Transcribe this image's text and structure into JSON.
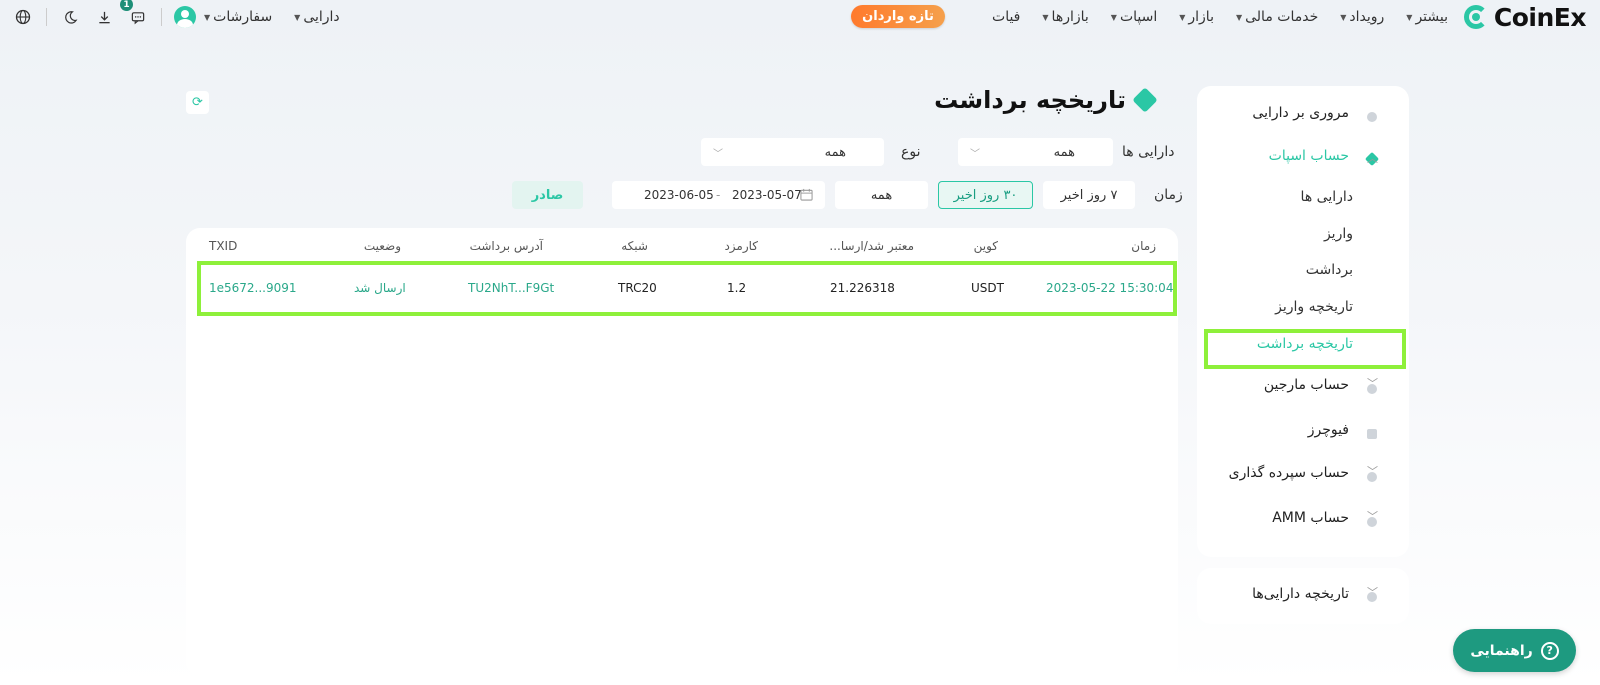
{
  "header": {
    "brand": "CoinEx",
    "nav": [
      {
        "label": "فیات",
        "caret": false
      },
      {
        "label": "بازارها",
        "caret": true
      },
      {
        "label": "اسپات",
        "caret": true
      },
      {
        "label": "بازار",
        "caret": true
      },
      {
        "label": "خدمات مالی",
        "caret": true
      },
      {
        "label": "رویداد",
        "caret": true
      },
      {
        "label": "بیشتر",
        "caret": true
      }
    ],
    "cta": "تازه واردان",
    "assets_menu": "دارایی",
    "orders_menu": "سفارشات",
    "notification_count": "1"
  },
  "sidebar": {
    "overview": "مروری بر دارایی",
    "spot_account": "حساب اسپات",
    "spot_sub": [
      "دارایی ها",
      "واریز",
      "برداشت",
      "تاریخچه واریز",
      "تاریخچه برداشت"
    ],
    "margin_account": "حساب مارجین",
    "futures": "فیوچرز",
    "staking_account": "حساب سپرده گذاری",
    "amm_account": "حساب AMM",
    "assets_history": "تاریخچه دارایی‌ها"
  },
  "main": {
    "title": "تاریخچه برداشت",
    "filters": {
      "asset_label": "دارایی ها",
      "asset_value": "همه",
      "type_label": "نوع",
      "type_value": "همه",
      "time_label": "زمان",
      "range_7": "۷ روز اخیر",
      "range_30": "۳۰ روز اخیر",
      "range_all": "همه",
      "date_start": "2023-05-07",
      "date_sep": "-",
      "date_end": "2023-06-05",
      "export": "صادر"
    },
    "table": {
      "headers": {
        "time": "زمان",
        "coin": "کوین",
        "amount": "معتبر شد/ارسا...",
        "fee": "کارمزد",
        "network": "شبکه",
        "address": "آدرس برداشت",
        "status": "وضعیت",
        "txid": "TXID"
      },
      "rows": [
        {
          "time": "2023-05-22  15:30:04",
          "coin": "USDT",
          "amount": "21.226318",
          "fee": "1.2",
          "network": "TRC20",
          "address": "TU2NhT...F9Gt",
          "status": "ارسال شد",
          "txid": "1e5672...9091"
        }
      ]
    }
  },
  "help_button": "راهنمایی",
  "colors": {
    "accent": "#2bc7a5",
    "highlight": "#8ef03a",
    "cta": "#ff7a2d"
  }
}
